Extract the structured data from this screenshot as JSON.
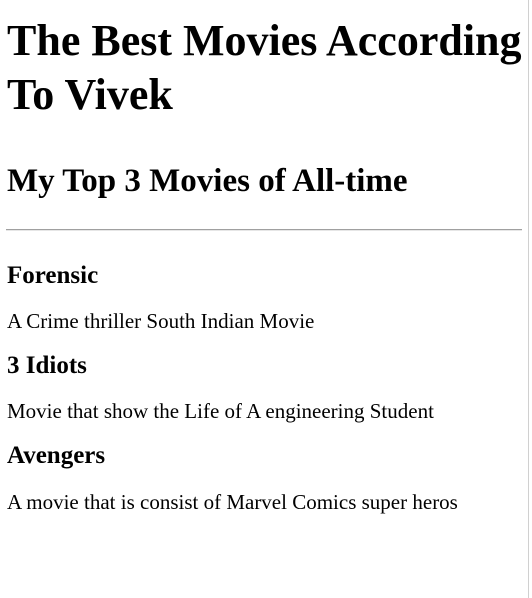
{
  "header": {
    "title": "The Best Movies According To Vivek",
    "subtitle": "My Top 3 Movies of All-time"
  },
  "movies": [
    {
      "name": "Forensic",
      "description": "A Crime thriller South Indian Movie"
    },
    {
      "name": "3 Idiots",
      "description": "Movie that show the Life of A engineering Student"
    },
    {
      "name": "Avengers",
      "description": "A movie that is consist of Marvel Comics super heros"
    }
  ]
}
